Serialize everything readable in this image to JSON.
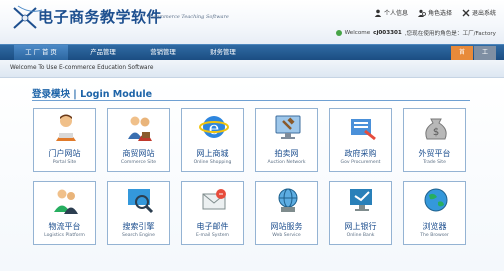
{
  "header": {
    "title_cn": "电子商务教学软件",
    "title_en": "E-commerce Teaching Software",
    "links": [
      {
        "label": "个人信息",
        "icon": "person-icon"
      },
      {
        "label": "角色选择",
        "icon": "role-icon"
      },
      {
        "label": "退出系统",
        "icon": "exit-icon"
      }
    ],
    "welcome_prefix": "Welcome",
    "user": "cj003301",
    "welcome_suffix": ",您现在使用的角色是：工厂/Factory"
  },
  "nav": {
    "items": [
      "工 厂 首 页",
      "产品管理",
      "营销管理",
      "财务管理"
    ],
    "right_buttons": [
      "首",
      "工"
    ]
  },
  "breadcrumb": "Welcome To Use E-commerce Education Software",
  "section_title": "登录模块 | Login Module",
  "modules": [
    {
      "cn": "门户网站",
      "en": "Portal Site",
      "icon": "portal-person-icon"
    },
    {
      "cn": "商贸网站",
      "en": "Commerce Site",
      "icon": "business-people-icon"
    },
    {
      "cn": "网上商城",
      "en": "Online Shopping",
      "icon": "internet-explorer-icon"
    },
    {
      "cn": "拍卖网",
      "en": "Auction Network",
      "icon": "auction-monitor-icon"
    },
    {
      "cn": "政府采购",
      "en": "Gov Procurement",
      "icon": "government-procurement-icon"
    },
    {
      "cn": "外贸平台",
      "en": "Trade Site",
      "icon": "money-bag-icon"
    },
    {
      "cn": "物流平台",
      "en": "Logistics Platform",
      "icon": "logistics-people-icon"
    },
    {
      "cn": "搜索引擎",
      "en": "Search Engine",
      "icon": "search-engine-icon"
    },
    {
      "cn": "电子邮件",
      "en": "E-mail System",
      "icon": "email-icon"
    },
    {
      "cn": "网站服务",
      "en": "Web Service",
      "icon": "web-service-icon"
    },
    {
      "cn": "网上银行",
      "en": "Online Bank",
      "icon": "online-bank-icon"
    },
    {
      "cn": "浏览器",
      "en": "The Browser",
      "icon": "browser-globe-icon"
    }
  ],
  "colors": {
    "nav": "#1b4d82",
    "accent": "#1d63a8",
    "tile_border": "#94b3d3"
  }
}
